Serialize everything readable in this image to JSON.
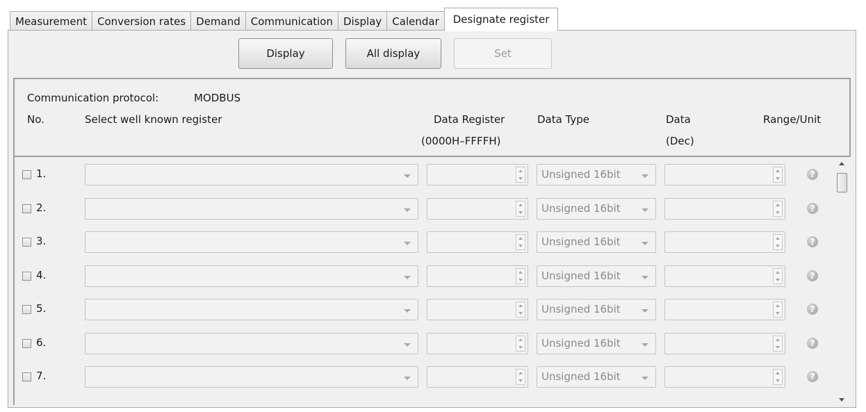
{
  "tabs": [
    {
      "label": "Measurement"
    },
    {
      "label": "Conversion rates"
    },
    {
      "label": "Demand"
    },
    {
      "label": "Communication"
    },
    {
      "label": "Display"
    },
    {
      "label": "Calendar"
    },
    {
      "label": "Designate register"
    }
  ],
  "active_tab": "Designate register",
  "toolbar": {
    "display_label": "Display",
    "all_display_label": "All display",
    "set_label": "Set"
  },
  "header": {
    "protocol_label": "Communication protocol:",
    "protocol_value": "MODBUS",
    "col_no": "No.",
    "col_register": "Select well known register",
    "col_data_register": "Data Register",
    "col_data_register_range": "(0000H–FFFFH)",
    "col_data_type": "Data Type",
    "col_data": "Data",
    "col_data_sub": "(Dec)",
    "col_range_unit": "Range/Unit"
  },
  "rows": [
    {
      "no": "1.",
      "data_type": "Unsigned 16bit"
    },
    {
      "no": "2.",
      "data_type": "Unsigned 16bit"
    },
    {
      "no": "3.",
      "data_type": "Unsigned 16bit"
    },
    {
      "no": "4.",
      "data_type": "Unsigned 16bit"
    },
    {
      "no": "5.",
      "data_type": "Unsigned 16bit"
    },
    {
      "no": "6.",
      "data_type": "Unsigned 16bit"
    },
    {
      "no": "7.",
      "data_type": "Unsigned 16bit"
    }
  ],
  "help_glyph": "?"
}
